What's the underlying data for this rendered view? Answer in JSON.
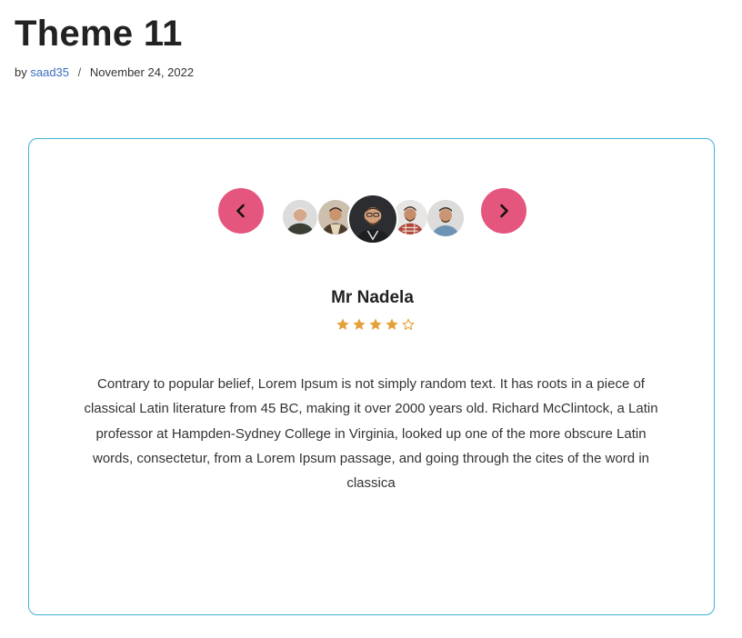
{
  "page": {
    "title": "Theme 11",
    "by_label": "by",
    "author": "saad35",
    "separator": "/",
    "date": "November 24, 2022"
  },
  "testimonial": {
    "name": "Mr Nadela",
    "rating": 4,
    "rating_max": 5,
    "text": "Contrary to popular belief, Lorem Ipsum is not simply random text. It has roots in a piece of classical Latin literature from 45 BC, making it over 2000 years old. Richard McClintock, a Latin professor at Hampden-Sydney College in Virginia, looked up one of the more obscure Latin words, consectetur, from a Lorem Ipsum passage, and going through the cites of the word in classica"
  },
  "carousel": {
    "prev_icon": "chevron-left-icon",
    "next_icon": "chevron-right-icon",
    "active_index": 2,
    "avatar_count": 5
  },
  "colors": {
    "accent": "#e5567f",
    "card_border": "#3fb2d6",
    "star": "#e4a03a",
    "link": "#3a6ec0"
  }
}
